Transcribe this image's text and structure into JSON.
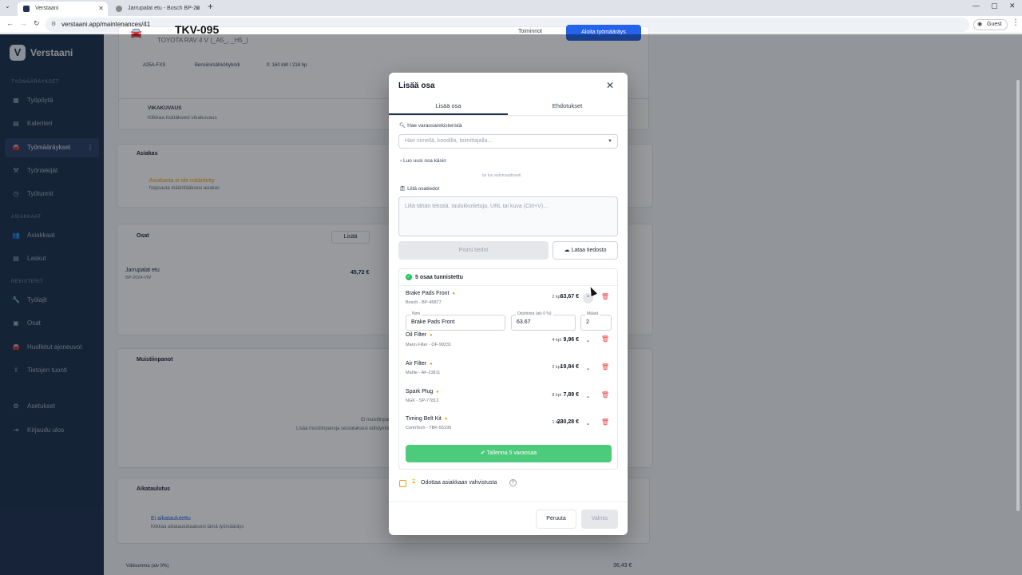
{
  "browser": {
    "tabs": [
      {
        "title": "Verstaani",
        "active": true
      },
      {
        "title": "Jarrupalat etu - Bosch BP-20",
        "active": false
      }
    ],
    "url": "verstaani.app/maintenances/41",
    "guest_label": "Guest"
  },
  "sidebar": {
    "logo_mark": "V",
    "logo_text": "Verstaani",
    "sections": [
      {
        "title": "TYÖMÄÄRÄYKSET",
        "items": [
          {
            "label": "Työpöytä",
            "icon": "dashboard-icon"
          },
          {
            "label": "Kalenteri",
            "icon": "calendar-icon"
          },
          {
            "label": "Työmääräykset",
            "icon": "car-icon",
            "active": true
          },
          {
            "label": "Työntekijät",
            "icon": "worker-icon"
          },
          {
            "label": "Työtunnit",
            "icon": "clock-icon"
          }
        ]
      },
      {
        "title": "ASIAKKAAT",
        "items": [
          {
            "label": "Asiakkaat",
            "icon": "users-icon"
          },
          {
            "label": "Laskut",
            "icon": "invoice-icon"
          }
        ]
      },
      {
        "title": "REKISTERIT",
        "items": [
          {
            "label": "Työlajit",
            "icon": "wrench-icon"
          },
          {
            "label": "Osat",
            "icon": "box-icon"
          },
          {
            "label": "Huolletut ajoneuvot",
            "icon": "car-icon"
          },
          {
            "label": "Tietojen tuonti",
            "icon": "upload-icon"
          }
        ]
      }
    ],
    "bottom_items": [
      {
        "label": "Asetukset",
        "icon": "gear-icon"
      },
      {
        "label": "Kirjaudu ulos",
        "icon": "logout-icon"
      }
    ]
  },
  "page": {
    "vehicle_title": "TKV-095",
    "vehicle_sub": "TOYOTA RAV 4 V (_A5_, _H5_)",
    "actions_label": "Toiminnot",
    "start_button": "Aloita työmääräys",
    "spec_engine": "A25A-FXS",
    "spec_fuel": "Bensiini/sähköhybridi",
    "spec_power": "0: 160 kW / 218 hp",
    "fault_title": "VIKAKUVAUS",
    "fault_sub": "Klikkaa lisätäksesi vikakuvaus",
    "customer_title": "Asiakas",
    "customer_empty": "Asiakasta ei ole määritetty",
    "customer_hint": "Napsauta määrittääksesi asiakas",
    "parts_title": "Osat",
    "parts_add": "Lisää",
    "part_row_name": "Jarrupalat etu",
    "part_row_code": "BP-2024-VW",
    "part_row_price": "45,72 €",
    "notes_title": "Muistiinpanot",
    "notes_empty": "Ei muistiinpanoja",
    "notes_hint": "Lisää muistiinpanoja seurataksesi edistymistä",
    "schedule_title": "Aikataulutus",
    "schedule_empty": "Ei aikataulutettu",
    "schedule_hint": "Klikkaa aikatauluttaaksesi tämä työmääräys",
    "total_label": "Välisumma (alv 0%)",
    "total_value": "36,43 €"
  },
  "modal": {
    "title": "Lisää osa",
    "tabs": [
      "Lisää osa",
      "Ehdotukset"
    ],
    "search_label": "Hae varaosarekisteristä",
    "search_placeholder": "Hae nimellä, koodilla, toimittajalla...",
    "create_manual": "Luo uusi osa käsin",
    "divider_text": "tai tuo automaattisesti",
    "paste_label": "Liitä osatiedot",
    "paste_placeholder": "Liitä tähän tekstiä, taulukkotietoja, URL tai kuva (Ctrl+V)...",
    "extract_button": "Poimi tiedot",
    "upload_button": "Lataa tiedosto",
    "found_text": "5 osaa tunnistettu",
    "parts": [
      {
        "name": "Brake Pads Front",
        "sub": "Bosch - BP-45877",
        "qty": "2 kpl",
        "price": "63,67 €",
        "expanded": true
      },
      {
        "name": "Oil Filter",
        "sub": "Mann Filter - OF-99231",
        "qty": "4 kpl",
        "price": "9,96 €"
      },
      {
        "name": "Air Filter",
        "sub": "Mahle - AF-23811",
        "qty": "2 kpl",
        "price": "19,84 €"
      },
      {
        "name": "Spark Plug",
        "sub": "NGK - SP-77812",
        "qty": "8 kpl",
        "price": "7,89 €"
      },
      {
        "name": "Timing Belt Kit",
        "sub": "ContiTech - TBK-55199",
        "qty": "1 kpl",
        "price": "230,28 €"
      }
    ],
    "edit": {
      "name_label": "Nimi",
      "name_value": "Brake Pads Front",
      "price_label": "Ostohinta (alv 0 %)",
      "price_value": "63.67",
      "qty_label": "Määrä",
      "qty_value": "2"
    },
    "save_button": "Tallenna 5 varaosaa",
    "await_label": "Odottaa asiakkaan vahvistusta",
    "cancel_button": "Peruuta",
    "done_button": "Valmis"
  }
}
